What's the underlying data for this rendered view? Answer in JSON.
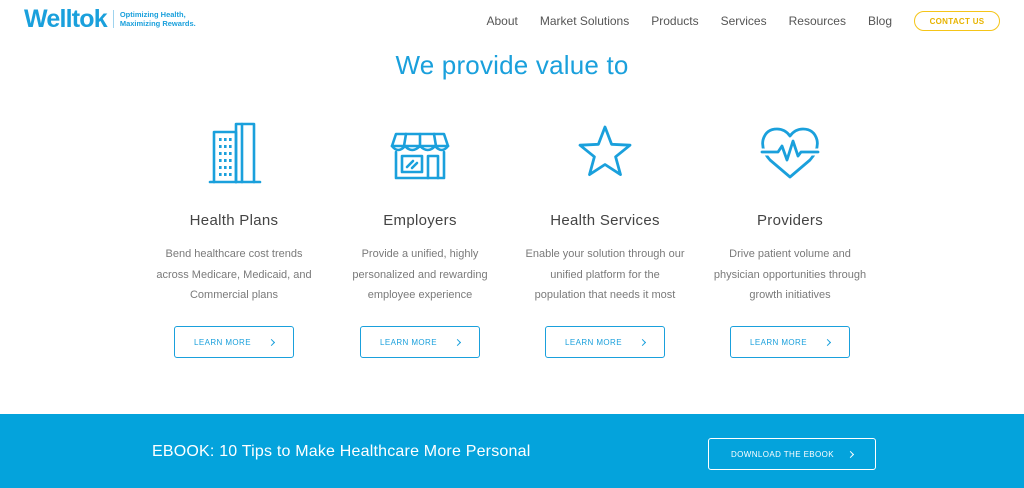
{
  "brand": {
    "logo_text": "Welltok",
    "tagline_line1": "Optimizing Health,",
    "tagline_line2": "Maximizing Rewards.",
    "accent_color": "#1aa0dc",
    "contact_color": "#f5c518",
    "banner_color": "#04a3dc"
  },
  "nav": {
    "items": [
      "About",
      "Market Solutions",
      "Products",
      "Services",
      "Resources",
      "Blog"
    ],
    "contact_label": "CONTACT US"
  },
  "section": {
    "title": "We provide value to"
  },
  "cards": [
    {
      "icon": "building-icon",
      "title": "Health Plans",
      "desc_lines": [
        "Bend healthcare cost trends",
        "across Medicare, Medicaid, and",
        "Commercial plans"
      ],
      "button": "LEARN MORE"
    },
    {
      "icon": "storefront-icon",
      "title": "Employers",
      "desc_lines": [
        "Provide a unified, highly",
        "personalized and rewarding",
        "employee experience"
      ],
      "button": "LEARN MORE"
    },
    {
      "icon": "star-icon",
      "title": "Health Services",
      "desc_lines": [
        "Enable your solution through our",
        "unified platform for the",
        "population that needs it most"
      ],
      "button": "LEARN MORE"
    },
    {
      "icon": "heart-pulse-icon",
      "title": "Providers",
      "desc_lines": [
        "Drive patient volume and",
        "physician opportunities through",
        "growth initiatives"
      ],
      "button": "LEARN MORE"
    }
  ],
  "banner": {
    "text": "EBOOK: 10 Tips to Make Healthcare More Personal",
    "button": "DOWNLOAD THE EBOOK"
  }
}
